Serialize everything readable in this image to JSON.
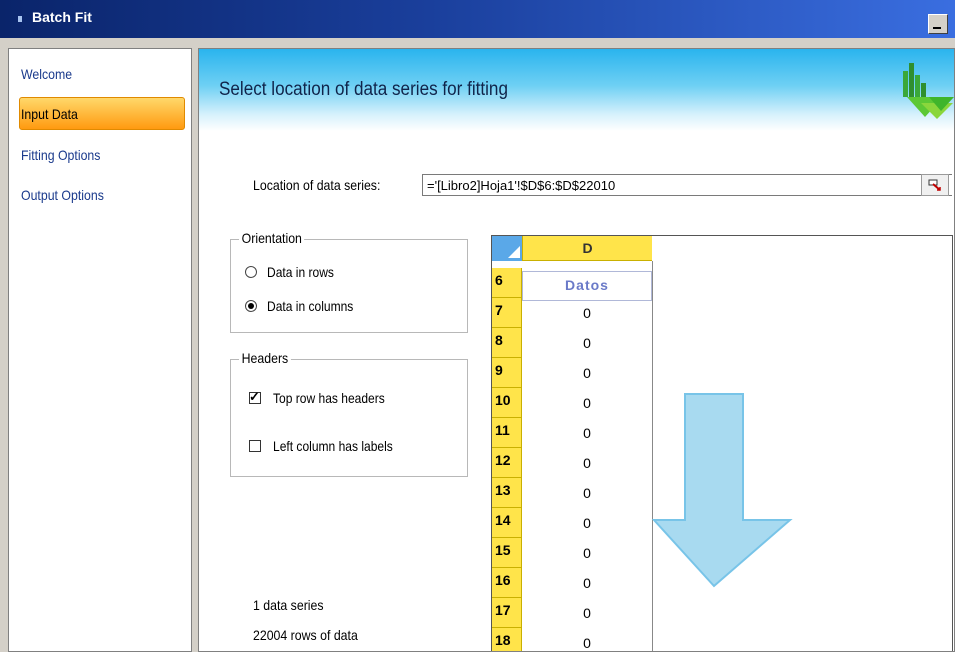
{
  "window": {
    "title": "Batch Fit"
  },
  "sidebar": {
    "items": [
      {
        "label": "Welcome",
        "active": false
      },
      {
        "label": "Input Data",
        "active": true
      },
      {
        "label": "Fitting Options",
        "active": false
      },
      {
        "label": "Output Options",
        "active": false
      }
    ]
  },
  "main": {
    "heading": "Select location of data series for fitting",
    "location_label": "Location of data series:",
    "location_value": "='[Libro2]Hoja1'!$D$6:$D$22010",
    "orientation": {
      "legend": "Orientation",
      "option_rows": "Data in rows",
      "option_columns": "Data in columns",
      "selected": "Data in columns"
    },
    "headers": {
      "legend": "Headers",
      "top_row_label": "Top row has headers",
      "top_row_checked": true,
      "left_col_label": "Left column has labels",
      "left_col_checked": false
    },
    "summary": {
      "series_count": "1 data series",
      "rows_count": "22004 rows of data"
    },
    "sheet": {
      "column": "D",
      "rows": [
        {
          "num": "6",
          "value": "Datos"
        },
        {
          "num": "7",
          "value": "0"
        },
        {
          "num": "8",
          "value": "0"
        },
        {
          "num": "9",
          "value": "0"
        },
        {
          "num": "10",
          "value": "0"
        },
        {
          "num": "11",
          "value": "0"
        },
        {
          "num": "12",
          "value": "0"
        },
        {
          "num": "13",
          "value": "0"
        },
        {
          "num": "14",
          "value": "0"
        },
        {
          "num": "15",
          "value": "0"
        },
        {
          "num": "16",
          "value": "0"
        },
        {
          "num": "17",
          "value": "0"
        },
        {
          "num": "18",
          "value": "0"
        }
      ]
    }
  },
  "colors": {
    "title_bar": "#0a246a",
    "active_item": "#ff9a10",
    "banner": "#2ab4ee",
    "sheet_header": "#ffe44a",
    "arrow": "#a8daf0"
  }
}
